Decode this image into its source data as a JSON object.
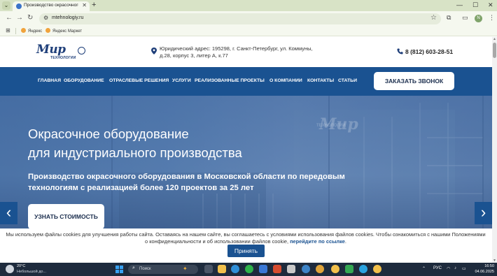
{
  "browser": {
    "tab_title": "Производство окрасочного о",
    "url": "mtehnologiy.ru",
    "profile_initial": "N",
    "bookmarks": [
      "Яндекс",
      "Яндекс Маркет"
    ]
  },
  "header": {
    "logo_text": "Мир",
    "logo_sub": "ТЕХНОЛОГИИ",
    "address": "Юридический адрес: 195298, г. Санкт-Петербург, ул. Коммуны, д.28, корпус 3, литер А, к.77",
    "phone": "8 (812) 603-28-51"
  },
  "nav": {
    "items": [
      {
        "label": "ГЛАВНАЯ"
      },
      {
        "label": "ОБОРУДОВАНИЕ"
      },
      {
        "label": "ОТРАСЛЕВЫЕ РЕШЕНИЯ"
      },
      {
        "label": "УСЛУГИ"
      },
      {
        "label": "РЕАЛИЗОВАННЫЕ ПРОЕКТЫ"
      },
      {
        "label": "О КОМПАНИИ"
      },
      {
        "label": "КОНТАКТЫ"
      },
      {
        "label": "СТАТЬИ"
      }
    ],
    "callback_label": "ЗАКАЗАТЬ ЗВОНОК"
  },
  "hero": {
    "watermark": "Мир",
    "watermark_sub": "ТЕХНОЛОГИИ",
    "title_line1": "Окрасочное оборудование",
    "title_line2": "для индустриального производства",
    "subtitle": "Производство окрасочного оборудования в Московской области по передовым технологиям с реализацией более 120 проектов за 25 лет",
    "cta_label": "УЗНАТЬ СТОИМОСТЬ",
    "prev_arrow": "‹",
    "next_arrow": "›"
  },
  "cookie": {
    "text": "Мы используем файлы cookies для улучшения работы сайта. Оставаясь на нашем сайте, вы соглашаетесь с условиями использования файлов cookies. Чтобы ознакомиться с нашими Положениями о конфиденциальности и об использовании файлов cookie, ",
    "link_text": "перейдите по ссылке",
    "text_end": ".",
    "accept_label": "Принять"
  },
  "taskbar": {
    "temperature": "20°C",
    "weather": "Небольшой до...",
    "search_placeholder": "Поиск",
    "language": "РУС",
    "time": "16:50",
    "date": "04.06.2025"
  },
  "colors": {
    "nav_bg": "#1a5291",
    "brand_dark": "#1f3f7a",
    "tab_strip": "#d8e3c6",
    "taskbar_bg": "#1e2b3d"
  },
  "icons": [
    "menu-icon",
    "favicon-icon",
    "close-icon",
    "new-tab-icon",
    "minimize-icon",
    "maximize-icon",
    "window-close-icon",
    "back-icon",
    "forward-icon",
    "reload-icon",
    "site-info-icon",
    "star-icon",
    "extensions-icon",
    "split-icon",
    "more-icon",
    "apps-icon",
    "map-pin-icon",
    "phone-icon",
    "chevron-left-icon",
    "chevron-right-icon",
    "weather-icon",
    "windows-start-icon",
    "search-icon"
  ]
}
